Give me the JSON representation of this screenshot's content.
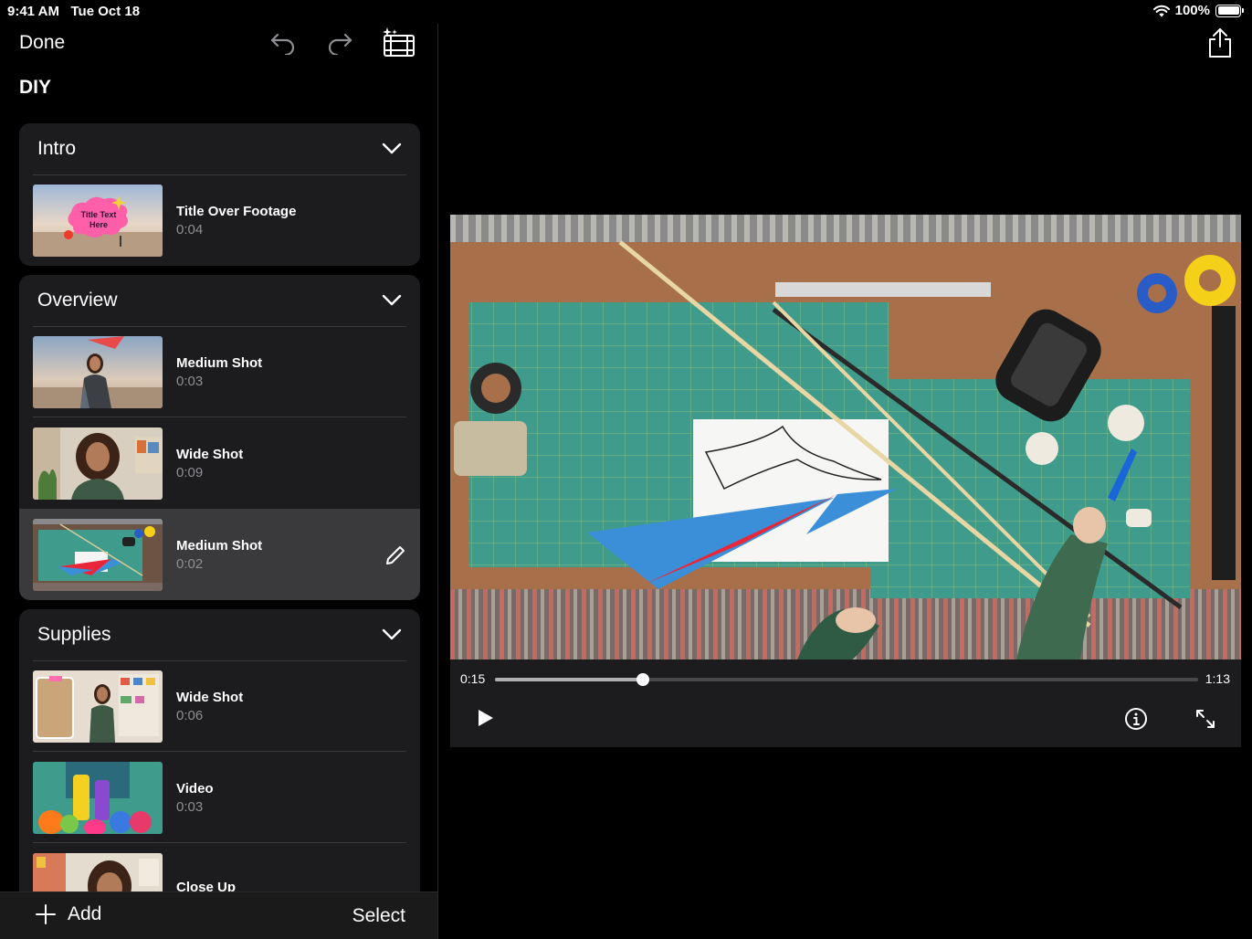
{
  "status": {
    "time": "9:41 AM",
    "date": "Tue Oct 18",
    "battery": "100%"
  },
  "toolbar": {
    "done_label": "Done"
  },
  "project": {
    "title": "DIY"
  },
  "sections": [
    {
      "label": "Intro",
      "clips": [
        {
          "name": "Title Over Footage",
          "duration": "0:04",
          "thumb_text": "Title Text Here"
        }
      ]
    },
    {
      "label": "Overview",
      "clips": [
        {
          "name": "Medium Shot",
          "duration": "0:03"
        },
        {
          "name": "Wide Shot",
          "duration": "0:09"
        },
        {
          "name": "Medium Shot",
          "duration": "0:02",
          "selected": true
        }
      ]
    },
    {
      "label": "Supplies",
      "clips": [
        {
          "name": "Wide Shot",
          "duration": "0:06"
        },
        {
          "name": "Video",
          "duration": "0:03"
        },
        {
          "name": "Close Up",
          "duration": ""
        }
      ]
    }
  ],
  "bottom": {
    "add_label": "Add",
    "select_label": "Select"
  },
  "player": {
    "current_time": "0:15",
    "total_time": "1:13",
    "progress": 0.21
  },
  "colors": {
    "panel": "#1c1c1e",
    "selected": "#3a3a3c",
    "secondary_text": "#8e8e93",
    "mat_green": "#3f9c8c",
    "kite_red": "#e8283a",
    "kite_blue": "#3a8fd8"
  },
  "icons": [
    "undo-icon",
    "redo-icon",
    "storyboard-icon",
    "chevron-down-icon",
    "pencil-icon",
    "plus-icon",
    "share-icon",
    "play-icon",
    "info-icon",
    "expand-icon",
    "wifi-icon",
    "battery-icon"
  ]
}
